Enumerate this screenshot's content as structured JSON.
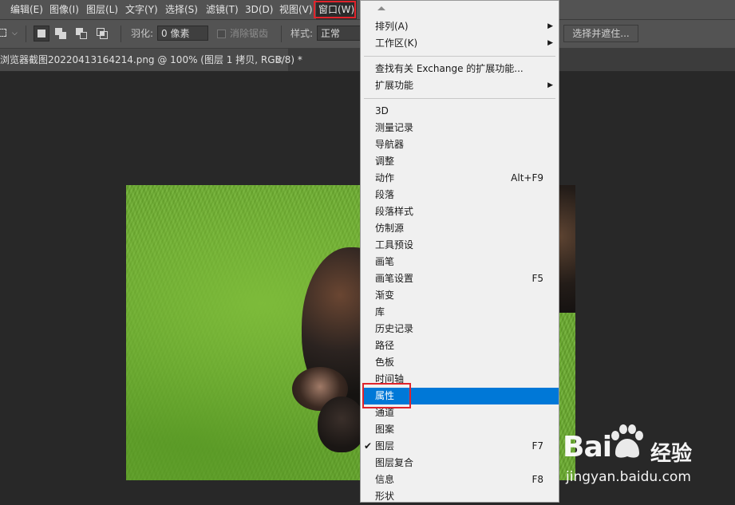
{
  "menubar": {
    "items": [
      "编辑(E)",
      "图像(I)",
      "图层(L)",
      "文字(Y)",
      "选择(S)",
      "滤镜(T)",
      "3D(D)",
      "视图(V)",
      "窗口(W)"
    ],
    "active": "窗口(W)"
  },
  "options": {
    "feather_label": "羽化:",
    "feather_value": "0 像素",
    "antialias_label": "消除锯齿",
    "style_label": "样式:",
    "style_value": "正常",
    "select_mask_label": "选择并遮住..."
  },
  "tab": {
    "title": "浏览器截图20220413164214.png @ 100% (图层 1 拷贝, RGB/8) *",
    "close": "×"
  },
  "menu": {
    "items": [
      {
        "label": "排列(A)",
        "submenu": true
      },
      {
        "label": "工作区(K)",
        "submenu": true
      },
      {
        "label": "查找有关 Exchange 的扩展功能..."
      },
      {
        "label": "扩展功能",
        "submenu": true
      },
      {
        "label": "3D"
      },
      {
        "label": "测量记录"
      },
      {
        "label": "导航器"
      },
      {
        "label": "调整"
      },
      {
        "label": "动作",
        "shortcut": "Alt+F9"
      },
      {
        "label": "段落"
      },
      {
        "label": "段落样式"
      },
      {
        "label": "仿制源"
      },
      {
        "label": "工具预设"
      },
      {
        "label": "画笔"
      },
      {
        "label": "画笔设置",
        "shortcut": "F5"
      },
      {
        "label": "渐变"
      },
      {
        "label": "库"
      },
      {
        "label": "历史记录"
      },
      {
        "label": "路径"
      },
      {
        "label": "色板"
      },
      {
        "label": "时间轴"
      },
      {
        "label": "属性",
        "highlighted": true
      },
      {
        "label": "通道"
      },
      {
        "label": "图案"
      },
      {
        "label": "图层",
        "shortcut": "F7",
        "checked": true
      },
      {
        "label": "图层复合"
      },
      {
        "label": "信息",
        "shortcut": "F8"
      },
      {
        "label": "形状"
      }
    ]
  },
  "watermark": {
    "brand": "Bai",
    "brand_cn": "经验",
    "url": "jingyan.baidu.com"
  },
  "colors": {
    "highlight": "#0078d7",
    "annotation": "#e0242c"
  }
}
